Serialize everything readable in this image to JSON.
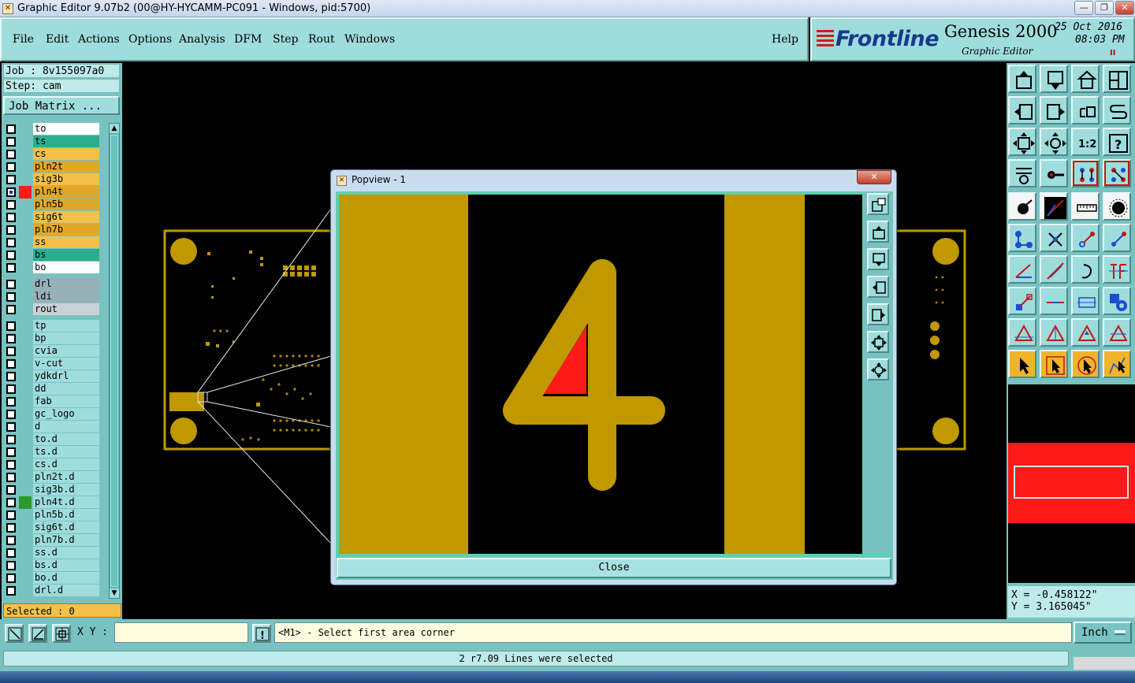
{
  "window": {
    "title": "Graphic Editor 9.07b2 (00@HY-HYCAMM-PC091 - Windows, pid:5700)",
    "minimize": "—",
    "maximize": "❐",
    "close": "✕"
  },
  "menu": {
    "items": [
      "File",
      "Edit",
      "Actions",
      "Options",
      "Analysis",
      "DFM",
      "Step",
      "Rout",
      "Windows"
    ],
    "help": "Help"
  },
  "brand": {
    "logo": "Frontline",
    "product": "Genesis 2000",
    "subtitle": "Graphic Editor",
    "date": "25 Oct 2016",
    "time": "08:03 PM",
    "alarm": "II"
  },
  "job": {
    "job_line": "Job : 8v155097a0",
    "step_line": "Step: cam",
    "matrix_button": "Job Matrix ..."
  },
  "layers": [
    {
      "name": "to",
      "bg": "#ffffff",
      "color": "",
      "checked": false
    },
    {
      "name": "ts",
      "bg": "#2bae90",
      "color": "",
      "checked": false
    },
    {
      "name": "cs",
      "bg": "#f3c04a",
      "color": "",
      "checked": false
    },
    {
      "name": "pln2t",
      "bg": "#e0a82a",
      "color": "",
      "checked": false
    },
    {
      "name": "sig3b",
      "bg": "#f3c04a",
      "color": "",
      "checked": false
    },
    {
      "name": "pln4t",
      "bg": "#e0a82a",
      "color": "#ff1a1a",
      "checked": true
    },
    {
      "name": "pln5b",
      "bg": "#e0a82a",
      "color": "",
      "checked": false
    },
    {
      "name": "sig6t",
      "bg": "#f3c04a",
      "color": "",
      "checked": false
    },
    {
      "name": "pln7b",
      "bg": "#e0a82a",
      "color": "",
      "checked": false
    },
    {
      "name": "ss",
      "bg": "#f3c04a",
      "color": "",
      "checked": false
    },
    {
      "name": "bs",
      "bg": "#2bae90",
      "color": "",
      "checked": false
    },
    {
      "name": "bo",
      "bg": "#ffffff",
      "color": "",
      "checked": false
    },
    {
      "name": "drl",
      "bg": "#9ab0b8",
      "color": "",
      "checked": false
    },
    {
      "name": "ldi",
      "bg": "#9ab0b8",
      "color": "",
      "checked": false
    },
    {
      "name": "rout",
      "bg": "#c8d2d6",
      "color": "",
      "checked": false
    },
    {
      "name": "tp",
      "bg": "#9fdcdc",
      "color": "",
      "checked": false
    },
    {
      "name": "bp",
      "bg": "#9fdcdc",
      "color": "",
      "checked": false
    },
    {
      "name": "cvia",
      "bg": "#9fdcdc",
      "color": "",
      "checked": false
    },
    {
      "name": "v-cut",
      "bg": "#9fdcdc",
      "color": "",
      "checked": false
    },
    {
      "name": "ydkdrl",
      "bg": "#9fdcdc",
      "color": "",
      "checked": false
    },
    {
      "name": "dd",
      "bg": "#9fdcdc",
      "color": "",
      "checked": false
    },
    {
      "name": "fab",
      "bg": "#9fdcdc",
      "color": "",
      "checked": false
    },
    {
      "name": "gc_logo",
      "bg": "#9fdcdc",
      "color": "",
      "checked": false
    },
    {
      "name": "d",
      "bg": "#9fdcdc",
      "color": "",
      "checked": false
    },
    {
      "name": "to.d",
      "bg": "#9fdcdc",
      "color": "",
      "checked": false
    },
    {
      "name": "ts.d",
      "bg": "#9fdcdc",
      "color": "",
      "checked": false
    },
    {
      "name": "cs.d",
      "bg": "#9fdcdc",
      "color": "",
      "checked": false
    },
    {
      "name": "pln2t.d",
      "bg": "#9fdcdc",
      "color": "",
      "checked": false
    },
    {
      "name": "sig3b.d",
      "bg": "#9fdcdc",
      "color": "",
      "checked": false
    },
    {
      "name": "pln4t.d",
      "bg": "#9fdcdc",
      "color": "#2a9a2a",
      "checked": false
    },
    {
      "name": "pln5b.d",
      "bg": "#9fdcdc",
      "color": "",
      "checked": false
    },
    {
      "name": "sig6t.d",
      "bg": "#9fdcdc",
      "color": "",
      "checked": false
    },
    {
      "name": "pln7b.d",
      "bg": "#9fdcdc",
      "color": "",
      "checked": false
    },
    {
      "name": "ss.d",
      "bg": "#9fdcdc",
      "color": "",
      "checked": false
    },
    {
      "name": "bs.d",
      "bg": "#9fdcdc",
      "color": "",
      "checked": false
    },
    {
      "name": "bo.d",
      "bg": "#9fdcdc",
      "color": "",
      "checked": false
    },
    {
      "name": "drl.d",
      "bg": "#9fdcdc",
      "color": "",
      "checked": false
    }
  ],
  "selected_label": "Selected : 0",
  "popview": {
    "title": "Popview - 1",
    "close_x": "✕",
    "close_button": "Close"
  },
  "coords": {
    "x": "X = -0.458122\"",
    "y": "Y = 3.165045\""
  },
  "command": {
    "xy_label": "X Y :",
    "xy_value": "",
    "warn": "!",
    "prompt": "<M1> - Select first area corner",
    "unit": "Inch"
  },
  "status_message": "2 r7.09 Lines were selected",
  "colors": {
    "panel": "#79c2c2",
    "copper": "#c09800",
    "highlight": "#ff1a1a"
  }
}
